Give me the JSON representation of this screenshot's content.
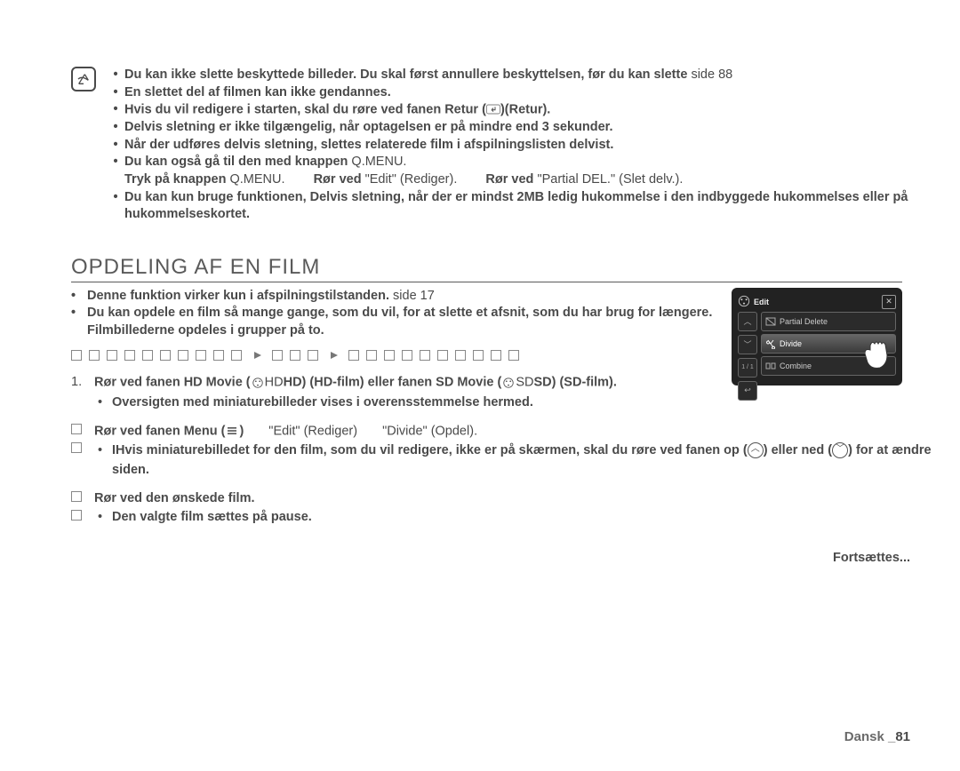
{
  "notes": {
    "b1_a": "Du kan ikke slette beskyttede billeder. Du skal først annullere beskyttelsen, før du kan slette",
    "b1_b": "side 88",
    "b2": "En slettet del af filmen kan ikke gendannes.",
    "b3_a": "Hvis du vil redigere i starten, skal du røre ved fanen Retur (",
    "b3_b": ")(Retur).",
    "b4": "Delvis sletning er ikke tilgængelig, når optagelsen er på mindre end 3 sekunder.",
    "b5": "Når der udføres delvis sletning, slettes relaterede film i afspilningslisten delvist.",
    "b6_a": "Du kan også gå til den med knappen ",
    "b6_b": "Q.MENU.",
    "b6_sub_a": "Tryk på knappen ",
    "b6_sub_b": "Q.MENU. ",
    "b6_sub_c": "Rør ved ",
    "b6_sub_d": "\"Edit\"",
    "b6_sub_e": " (Rediger). ",
    "b6_sub_f": "Rør ved ",
    "b6_sub_g": "\"Partial DEL.\"",
    "b6_sub_h": " (Slet delv.).",
    "b7": "Du kan kun bruge funktionen, Delvis sletning, når der er mindst 2MB ledig hukommelse i den indbyggede hukommelses eller på hukommelseskortet."
  },
  "section_title": "OPDELING AF EN FILM",
  "intro": {
    "l1_a": "Denne funktion virker kun i afspilningstilstanden. ",
    "l1_b": "side 17",
    "l2": "Du kan opdele en film så mange gange, som du vil, for at slette et afsnit, som du har brug for længere. Filmbillederne opdeles i grupper på to."
  },
  "steps": {
    "s1_a": "Rør ved fanen HD Movie (",
    "s1_b": "HD) (HD-film) eller fanen SD Movie (",
    "s1_c": "SD) (SD-film).",
    "s1_sub": "Oversigten med miniaturebilleder vises i overensstemmelse hermed.",
    "s2_a": "Rør ved fanen Menu (",
    "s2_b": ") ",
    "s2_c": "\"Edit\"",
    "s2_d": " (Rediger) ",
    "s2_e": "\"Divide\"",
    "s2_f": " (Opdel)",
    "s2_g": ".",
    "s2_sub_a": "IHvis miniaturebilledet for den film, som du vil redigere, ikke er på skærmen, skal du røre ved fanen op (",
    "s2_sub_b": ") eller ned (",
    "s2_sub_c": ") for at ændre siden.",
    "s3_a": "Rør ved den ønskede film.",
    "s3_sub": "Den valgte film sættes på pause."
  },
  "device": {
    "edit": "Edit",
    "item1": "Partial Delete",
    "item2": "Divide",
    "item3": "Combine",
    "page": "1 / 1"
  },
  "continue": "Fortsættes...",
  "footer_label": "Dansk _",
  "footer_page": "81"
}
